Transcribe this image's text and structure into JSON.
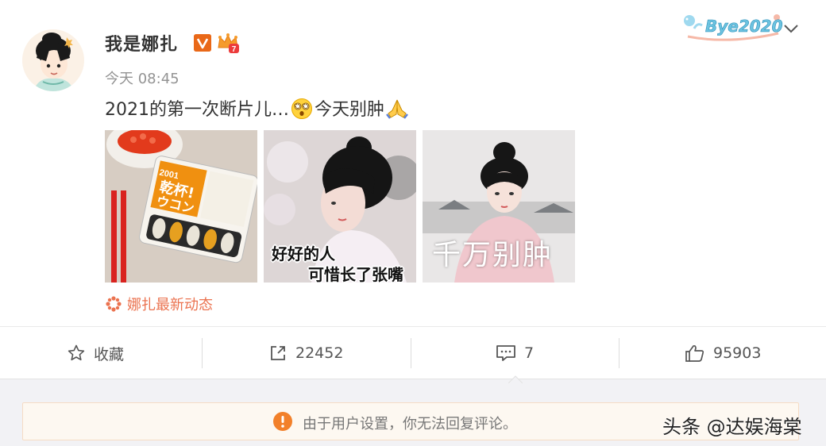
{
  "post": {
    "username": "我是娜扎",
    "verified_badge": "V",
    "crown_level": "7",
    "time": "今天 08:45",
    "text_before": "2021的第一次断片儿…",
    "text_after": "今天别肿",
    "emoji_names": [
      "dizzy-face-emoji",
      "praying-hands-emoji"
    ],
    "images": [
      {
        "name": "photo-supplement-pack",
        "pack_title_line1": "乾杯!",
        "pack_title_line2": "ウコン",
        "pack_top": "2001"
      },
      {
        "name": "photo-meme-1",
        "caption_line1": "好好的人",
        "caption_line2": "可惜长了张嘴"
      },
      {
        "name": "photo-meme-2",
        "caption": "千万别肿"
      }
    ],
    "source_label": "娜扎最新动态"
  },
  "decoration": {
    "bye_text": "Bye2020"
  },
  "actions": {
    "favorite_label": "收藏",
    "repost_count": "22452",
    "comment_count": "7",
    "like_count": "95903"
  },
  "notice": {
    "text": "由于用户设置，你无法回复评论。"
  },
  "watermark": "头条 @达娱海棠",
  "colors": {
    "accent": "#eb7350",
    "vbadge": "#e96818",
    "notice_bg": "#fdf8f1",
    "page_bg": "#f2f2f5"
  }
}
